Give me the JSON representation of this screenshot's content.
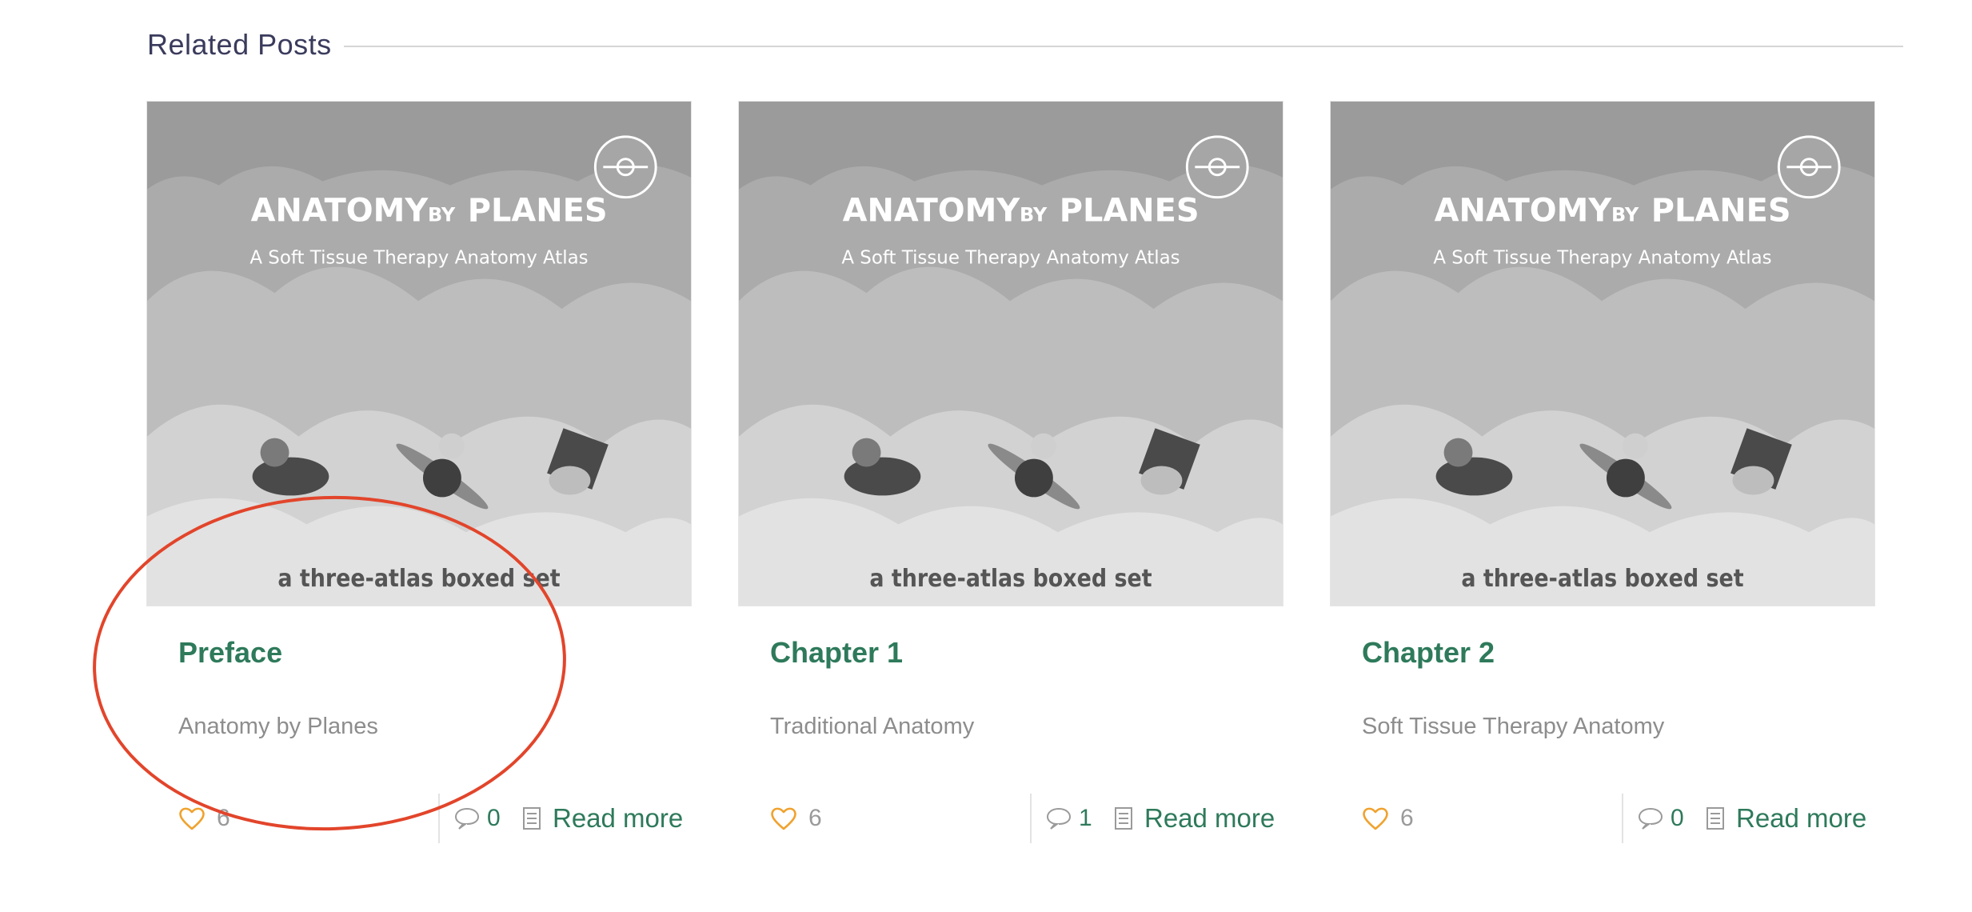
{
  "section": {
    "title": "Related Posts"
  },
  "cover": {
    "title_main": "ANATOMY",
    "title_by": "BY",
    "title_end": "PLANES",
    "subtitle": "A Soft Tissue Therapy Anatomy Atlas",
    "tagline": "a three-atlas boxed set"
  },
  "posts": [
    {
      "title": "Preface",
      "excerpt": "Anatomy by Planes",
      "likes": "6",
      "comments": "0",
      "read_more": "Read more"
    },
    {
      "title": "Chapter 1",
      "excerpt": "Traditional Anatomy",
      "likes": "6",
      "comments": "1",
      "read_more": "Read more"
    },
    {
      "title": "Chapter 2",
      "excerpt": "Soft Tissue Therapy Anatomy",
      "likes": "6",
      "comments": "0",
      "read_more": "Read more"
    }
  ],
  "colors": {
    "accent": "#2e7a5b",
    "like": "#f0a22e",
    "highlight": "#e2452b",
    "muted": "#8d8d8d"
  }
}
